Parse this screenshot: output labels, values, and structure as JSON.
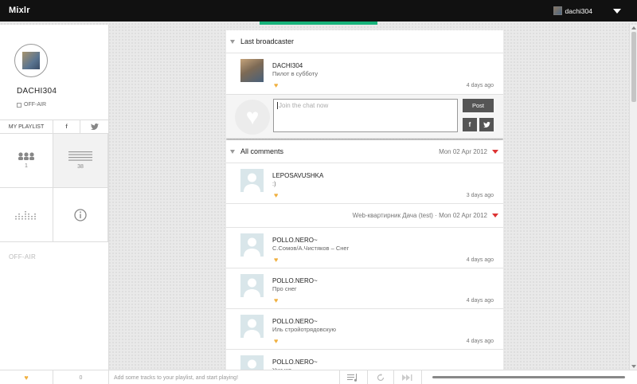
{
  "app": {
    "logo": "Mixlr"
  },
  "topbar": {
    "username": "dachi304",
    "menu_icon": "caret-down-icon"
  },
  "sidebar": {
    "profile_name": "DACHI304",
    "status": "OFF-AIR",
    "playlist_label": "MY PLAYLIST",
    "facebook_icon": "f",
    "twitter_icon": "t",
    "followers_count": "1",
    "tracks_count": "38",
    "footer_status": "OFF-AIR"
  },
  "feed": {
    "last_broadcaster_title": "Last broadcaster",
    "broadcaster": {
      "name": "DACHI304",
      "message": "Пилот в субботу",
      "time": "4 days ago"
    },
    "chat": {
      "placeholder": "Join the chat now",
      "post_label": "Post",
      "fb": "f",
      "tw": "t"
    },
    "all_comments_title": "All comments",
    "all_comments_date": "Mon 02 Apr 2012",
    "comment1": {
      "name": "LEPOSAVUSHKA",
      "message": ":)",
      "time": "3 days ago"
    },
    "subhead": "Web-квартирник Дача (test) · Mon 02 Apr 2012",
    "comments": [
      {
        "name": "POLLO.NERO~",
        "message": "С.Сомов/А.Чистяков – Снег",
        "time": "4 days ago"
      },
      {
        "name": "POLLO.NERO~",
        "message": "Про снег",
        "time": "4 days ago"
      },
      {
        "name": "POLLO.NERO~",
        "message": "Иль стройотрядовскую",
        "time": "4 days ago"
      },
      {
        "name": "POLLO.NERO~",
        "message": "Учи же",
        "time": ""
      }
    ]
  },
  "bottombar": {
    "likes_count": "0",
    "hint": "Add some tracks to your playlist, and start playing!"
  }
}
